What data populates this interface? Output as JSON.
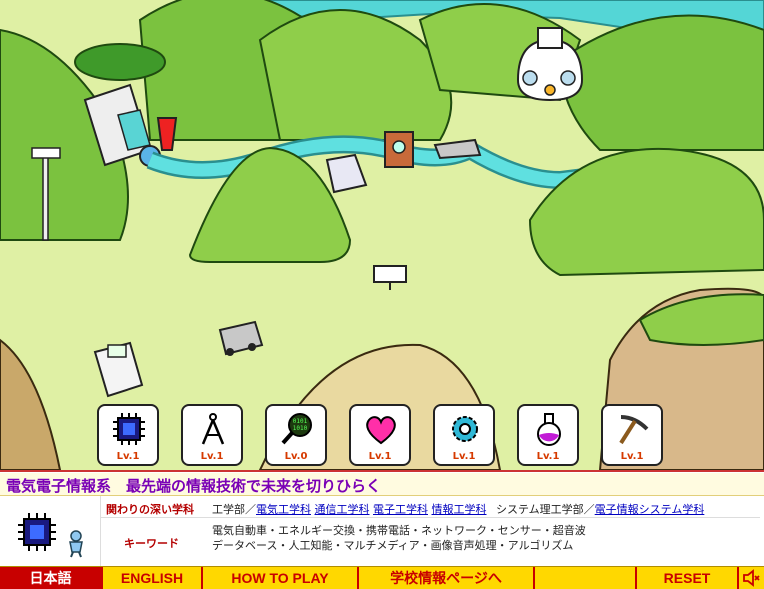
{
  "levels": [
    {
      "id": "electronics",
      "icon": "cpu-chip-icon",
      "label": "Lv.1"
    },
    {
      "id": "design",
      "icon": "compass-icon",
      "label": "Lv.1"
    },
    {
      "id": "data",
      "icon": "magnifier-binary-icon",
      "label": "Lv.0"
    },
    {
      "id": "life",
      "icon": "heart-icon",
      "label": "Lv.1"
    },
    {
      "id": "mechanical",
      "icon": "gear-icon",
      "label": "Lv.1"
    },
    {
      "id": "chemistry",
      "icon": "flask-icon",
      "label": "Lv.1"
    },
    {
      "id": "civil",
      "icon": "pickaxe-icon",
      "label": "Lv.1"
    }
  ],
  "info": {
    "title": "電気電子情報系　最先端の情報技術で未来を切りひらく",
    "related_label": "関わりの深い学科",
    "faculty1": "工学部／",
    "departments1": [
      "電気工学科",
      "通信工学科",
      "電子工学科",
      "情報工学科"
    ],
    "faculty2": "システム理工学部／",
    "departments2": [
      "電子情報システム学科"
    ],
    "keyword_label": "キーワード",
    "keywords_line1": "電気自動車・エネルギー交換・携帯電話・ネットワーク・センサー・超音波",
    "keywords_line2": "データベース・人工知能・マルチメディア・画像音声処理・アルゴリズム"
  },
  "nav": {
    "japanese": "日本語",
    "english": "ENGLISH",
    "how_to_play": "HOW TO PLAY",
    "school_info": "学校情報ページへ",
    "blank": "",
    "reset": "RESET"
  },
  "colors": {
    "accent_red": "#c80000",
    "nav_yellow": "#ffd800",
    "title_purple": "#7a00b6",
    "link_blue": "#0000c0",
    "level_text": "#d63a00"
  }
}
